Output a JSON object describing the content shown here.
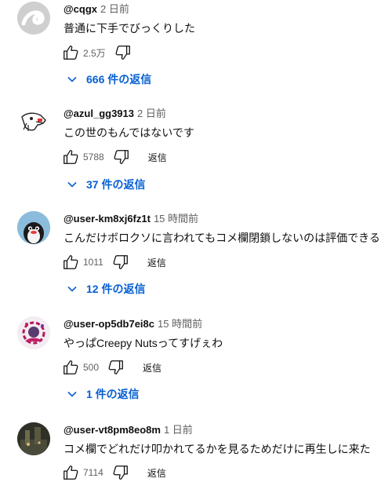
{
  "comments": [
    {
      "author": "@cqgx",
      "time": "2 日前",
      "text": "普通に下手でびっくりした",
      "likes": "2.5万",
      "reply_label": "",
      "replies": "666 件の返信",
      "avatar_icon": "white-curl-avatar"
    },
    {
      "author": "@azul_gg3913",
      "time": "2 日前",
      "text": "この世のもんではないです",
      "likes": "5788",
      "reply_label": "返信",
      "replies": "37 件の返信",
      "avatar_icon": "sketch-creature-avatar"
    },
    {
      "author": "@user-km8xj6fz1t",
      "time": "15 時間前",
      "text": "こんだけボロクソに言われてもコメ欄閉鎖しないのは評価できる",
      "likes": "1011",
      "reply_label": "返信",
      "replies": "12 件の返信",
      "avatar_icon": "penguin-avatar"
    },
    {
      "author": "@user-op5db7ei8c",
      "time": "15 時間前",
      "text": "やっぱCreepy Nutsってすげぇわ",
      "likes": "500",
      "reply_label": "返信",
      "replies": "1 件の返信",
      "avatar_icon": "anime-art-avatar"
    },
    {
      "author": "@user-vt8pm8eo8m",
      "time": "1 日前",
      "text": "コメ欄でどれだけ叩かれてるかを見るためだけに再生しに来た",
      "likes": "7114",
      "reply_label": "返信",
      "replies": "",
      "avatar_icon": "night-scene-avatar"
    }
  ],
  "colors": {
    "link": "#065fd4",
    "secondary": "#606060",
    "text": "#0f0f0f"
  }
}
